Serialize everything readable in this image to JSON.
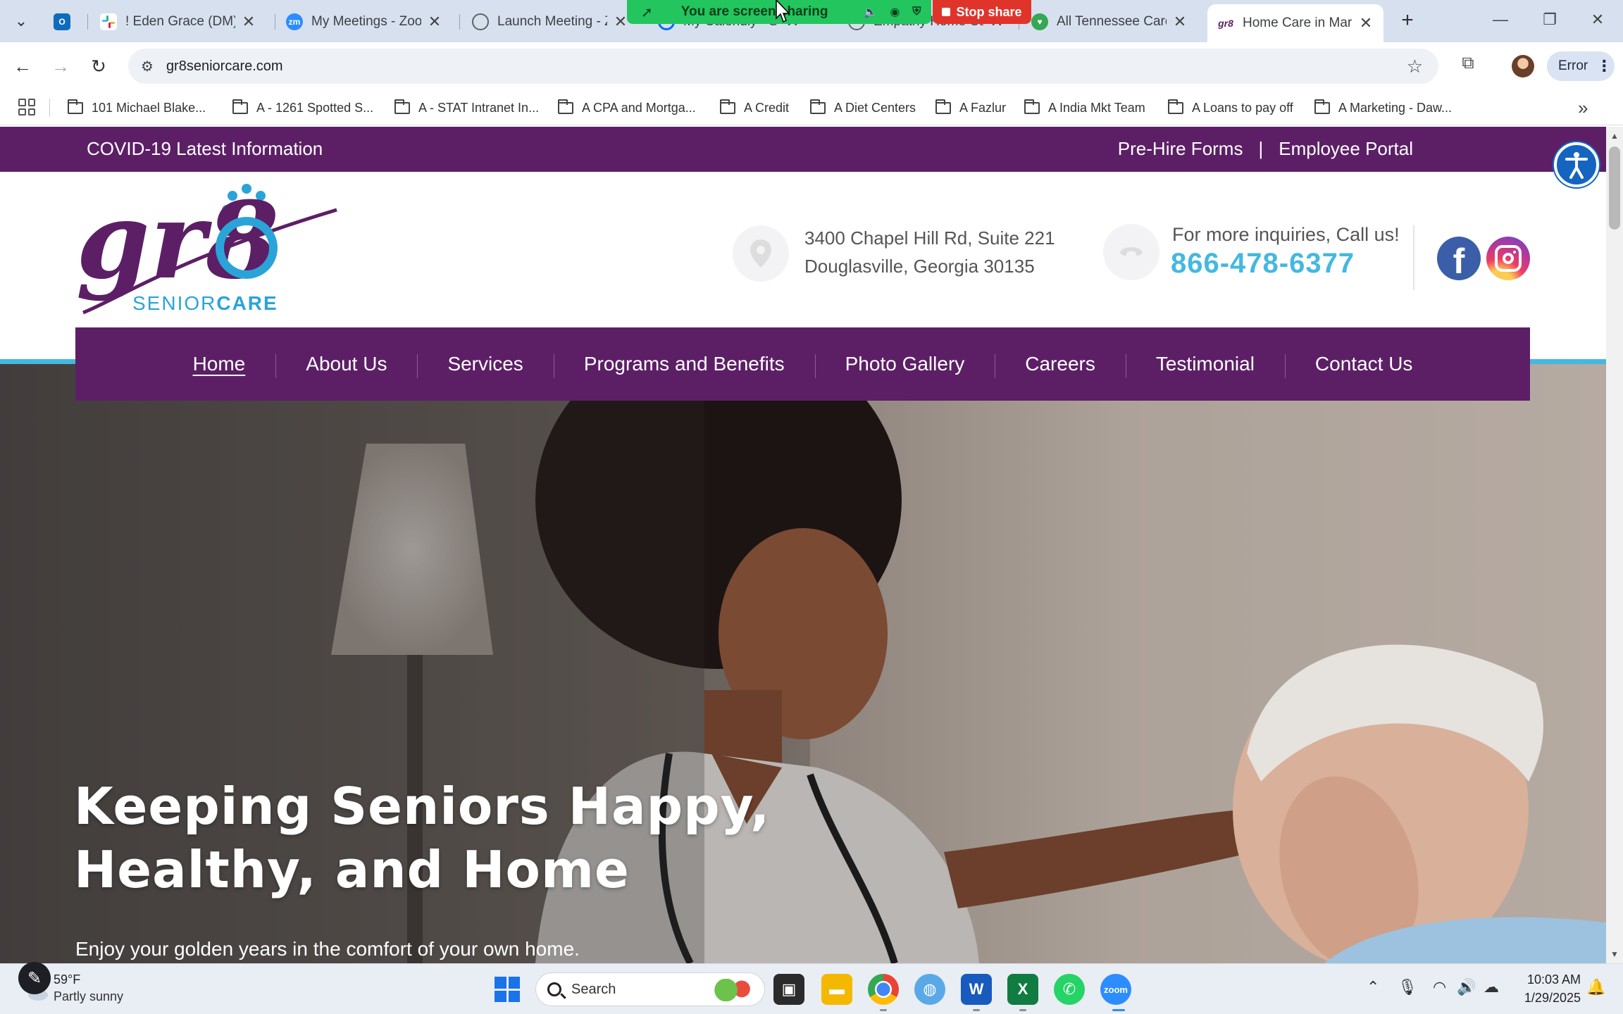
{
  "browser": {
    "tabs": [
      {
        "title": "",
        "favicon_color": "#0f6cbd"
      },
      {
        "title": "! Eden Grace (DM) -",
        "favicon_color": "#e01e5a"
      },
      {
        "title": "My Meetings - Zoom",
        "favicon_color": "#2d8cff"
      },
      {
        "title": "Launch Meeting - Z",
        "favicon_color": "#5f6368"
      },
      {
        "title": "My Calendly - Sche",
        "favicon_color": "#006bff"
      },
      {
        "title": "Empathy Home Car",
        "favicon_color": "#5f6368"
      },
      {
        "title": "All Tennessee CareC",
        "favicon_color": "#34a853"
      },
      {
        "title": "Home Care in Marie",
        "favicon_color": "#5c1f66"
      }
    ],
    "screen_share": {
      "label": "You are screen sharing",
      "stop_label": "Stop share"
    },
    "url": "gr8seniorcare.com",
    "profile_status": "Error",
    "bookmarks": [
      "101 Michael Blake...",
      "A - 1261 Spotted S...",
      "A - STAT Intranet In...",
      "A CPA and Mortga...",
      "A Credit",
      "A Diet Centers",
      "A Fazlur",
      "A India Mkt Team",
      "A Loans to pay off",
      "A Marketing - Daw..."
    ]
  },
  "site": {
    "topbar": {
      "covid": "COVID-19 Latest Information",
      "prehire": "Pre-Hire Forms",
      "sep": "|",
      "portal": "Employee Portal"
    },
    "logo": {
      "mark": "gr8",
      "senior": "SENIOR",
      "care": "CARE"
    },
    "address": {
      "line1": "3400 Chapel Hill Rd, Suite 221",
      "line2": "Douglasville, Georgia 30135"
    },
    "contact": {
      "prompt": "For more inquiries, Call us!",
      "phone": "866-478-6377"
    },
    "nav": [
      "Home",
      "About Us",
      "Services",
      "Programs and Benefits",
      "Photo Gallery",
      "Careers",
      "Testimonial",
      "Contact Us"
    ],
    "hero": {
      "title_line1": "Keeping Seniors Happy,",
      "title_line2": "Healthy, and Home",
      "subtitle": "Enjoy your golden years in the comfort of your own home."
    },
    "colors": {
      "brand_purple": "#5c1f66",
      "brand_blue": "#44b8e0"
    }
  },
  "taskbar": {
    "weather": {
      "temp": "59°F",
      "desc": "Partly sunny"
    },
    "search": "Search",
    "time": "10:03 AM",
    "date": "1/29/2025"
  }
}
